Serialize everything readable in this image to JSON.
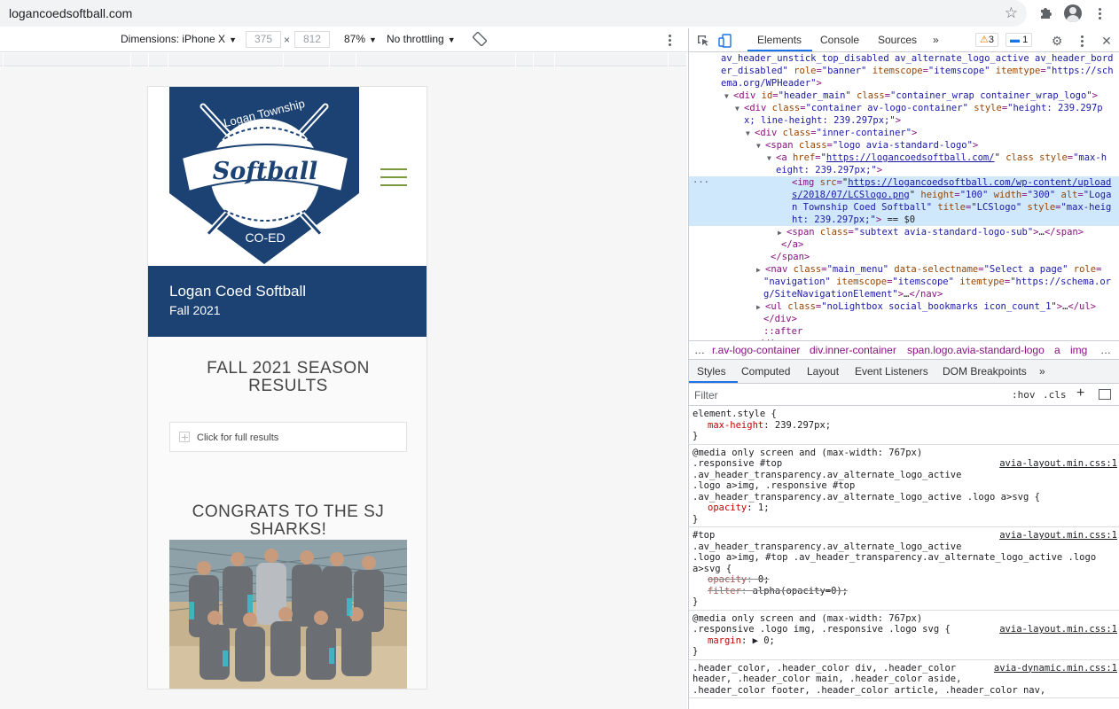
{
  "browser": {
    "url": "logancoedsoftball.com"
  },
  "device_toolbar": {
    "dimensions_label": "Dimensions: iPhone X",
    "width": "375",
    "height": "812",
    "times": "×",
    "zoom": "87%",
    "throttle": "No throttling"
  },
  "page": {
    "logo_text_top": "Logan Township",
    "logo_text_main": "Softball",
    "logo_text_bottom": "CO-ED",
    "site_title": "Logan Coed Softball",
    "site_subtitle": "Fall 2021",
    "heading1_line1": "FALL 2021 SEASON",
    "heading1_line2": "RESULTS",
    "accordion_label": "Click for full results",
    "heading2_line1": "CONGRATS TO THE SJ",
    "heading2_line2": "SHARKS!"
  },
  "devtools": {
    "tabs": [
      "Elements",
      "Console",
      "Sources"
    ],
    "more_tabs": "»",
    "warnings": "3",
    "messages": "1",
    "dom_lines": [
      {
        "indent": 36,
        "parts": [
          [
            "av",
            "av_header_unstick_top_disabled av_alternate_logo_active av_header_bord"
          ]
        ]
      },
      {
        "indent": 36,
        "parts": [
          [
            "av",
            "er_disabled\""
          ],
          [
            "an",
            " role"
          ],
          [
            "tn",
            "="
          ],
          [
            "av",
            "\"banner\""
          ],
          [
            "an",
            " itemscope"
          ],
          [
            "tn",
            "="
          ],
          [
            "av",
            "\"itemscope\""
          ],
          [
            "an",
            " itemtype"
          ],
          [
            "tn",
            "="
          ],
          [
            "av",
            "\"https://sch"
          ]
        ]
      },
      {
        "indent": 36,
        "parts": [
          [
            "av",
            "ema.org/WPHeader\""
          ],
          [
            "tn",
            ">"
          ]
        ]
      },
      {
        "indent": 50,
        "tri": "▼",
        "parts": [
          [
            "tn",
            "<div"
          ],
          [
            "an",
            " id"
          ],
          [
            "tn",
            "="
          ],
          [
            "av",
            "\"header_main\""
          ],
          [
            "an",
            " class"
          ],
          [
            "tn",
            "="
          ],
          [
            "av",
            "\"container_wrap container_wrap_logo\""
          ],
          [
            "tn",
            ">"
          ]
        ]
      },
      {
        "indent": 62,
        "tri": "▼",
        "parts": [
          [
            "tn",
            "<div"
          ],
          [
            "an",
            " class"
          ],
          [
            "tn",
            "="
          ],
          [
            "av",
            "\"container av-logo-container\""
          ],
          [
            "an",
            " style"
          ],
          [
            "tn",
            "="
          ],
          [
            "av",
            "\"height: 239.297p"
          ]
        ]
      },
      {
        "indent": 62,
        "parts": [
          [
            "av",
            "x; line-height: 239.297px;\""
          ],
          [
            "tn",
            ">"
          ]
        ]
      },
      {
        "indent": 74,
        "tri": "▼",
        "parts": [
          [
            "tn",
            "<div"
          ],
          [
            "an",
            " class"
          ],
          [
            "tn",
            "="
          ],
          [
            "av",
            "\"inner-container\""
          ],
          [
            "tn",
            ">"
          ]
        ]
      },
      {
        "indent": 86,
        "tri": "▼",
        "parts": [
          [
            "tn",
            "<span"
          ],
          [
            "an",
            " class"
          ],
          [
            "tn",
            "="
          ],
          [
            "av",
            "\"logo avia-standard-logo\""
          ],
          [
            "tn",
            ">"
          ]
        ]
      },
      {
        "indent": 98,
        "tri": "▼",
        "parts": [
          [
            "tn",
            "<a"
          ],
          [
            "an",
            " href"
          ],
          [
            "tn",
            "="
          ],
          [
            "tx",
            "\""
          ],
          [
            "ln",
            "https://logancoedsoftball.com/"
          ],
          [
            "tx",
            "\""
          ],
          [
            "an",
            " class style"
          ],
          [
            "tn",
            "="
          ],
          [
            "av",
            "\"max-h"
          ]
        ]
      },
      {
        "indent": 98,
        "parts": [
          [
            "av",
            "eight: 239.297px;\""
          ],
          [
            "tn",
            ">"
          ]
        ]
      },
      {
        "indent": 116,
        "sel": true,
        "parts": [
          [
            "tn",
            "<img"
          ],
          [
            "an",
            " src"
          ],
          [
            "tn",
            "="
          ],
          [
            "tx",
            "\""
          ],
          [
            "ln",
            "https://logancoedsoftball.com/wp-content/upload"
          ]
        ]
      },
      {
        "indent": 116,
        "sel": true,
        "parts": [
          [
            "ln",
            "s/2018/07/LCSlogo.png"
          ],
          [
            "tx",
            "\""
          ],
          [
            "an",
            " height"
          ],
          [
            "tn",
            "="
          ],
          [
            "av",
            "\"100\""
          ],
          [
            "an",
            " width"
          ],
          [
            "tn",
            "="
          ],
          [
            "av",
            "\"300\""
          ],
          [
            "an",
            " alt"
          ],
          [
            "tn",
            "="
          ],
          [
            "av",
            "\"Loga"
          ]
        ]
      },
      {
        "indent": 116,
        "sel": true,
        "parts": [
          [
            "av",
            "n Township Coed Softball\""
          ],
          [
            "an",
            " title"
          ],
          [
            "tn",
            "="
          ],
          [
            "av",
            "\"LCSlogo\""
          ],
          [
            "an",
            " style"
          ],
          [
            "tn",
            "="
          ],
          [
            "av",
            "\"max-heig"
          ]
        ]
      },
      {
        "indent": 116,
        "sel": true,
        "parts": [
          [
            "av",
            "ht: 239.297px;\""
          ],
          [
            "tn",
            ">"
          ],
          [
            "tx",
            " == $0"
          ]
        ]
      },
      {
        "indent": 110,
        "tri": "▶",
        "parts": [
          [
            "tn",
            "<span"
          ],
          [
            "an",
            " class"
          ],
          [
            "tn",
            "="
          ],
          [
            "av",
            "\"subtext avia-standard-logo-sub\""
          ],
          [
            "tn",
            ">"
          ],
          [
            "tx",
            "…"
          ],
          [
            "tn",
            "</span>"
          ]
        ]
      },
      {
        "indent": 104,
        "parts": [
          [
            "tn",
            "</a>"
          ]
        ]
      },
      {
        "indent": 92,
        "parts": [
          [
            "tn",
            "</span>"
          ]
        ]
      },
      {
        "indent": 86,
        "tri": "▶",
        "parts": [
          [
            "tn",
            "<nav"
          ],
          [
            "an",
            " class"
          ],
          [
            "tn",
            "="
          ],
          [
            "av",
            "\"main_menu\""
          ],
          [
            "an",
            " data-selectname"
          ],
          [
            "tn",
            "="
          ],
          [
            "av",
            "\"Select a page\""
          ],
          [
            "an",
            " role"
          ],
          [
            "tn",
            "="
          ]
        ]
      },
      {
        "indent": 84,
        "parts": [
          [
            "av",
            "\"navigation\""
          ],
          [
            "an",
            " itemscope"
          ],
          [
            "tn",
            "="
          ],
          [
            "av",
            "\"itemscope\""
          ],
          [
            "an",
            " itemtype"
          ],
          [
            "tn",
            "="
          ],
          [
            "av",
            "\"https://schema.or"
          ]
        ]
      },
      {
        "indent": 84,
        "parts": [
          [
            "av",
            "g/SiteNavigationElement\""
          ],
          [
            "tn",
            ">"
          ],
          [
            "tx",
            "…"
          ],
          [
            "tn",
            "</nav>"
          ]
        ]
      },
      {
        "indent": 86,
        "tri": "▶",
        "parts": [
          [
            "tn",
            "<ul"
          ],
          [
            "an",
            " class"
          ],
          [
            "tn",
            "="
          ],
          [
            "av",
            "\"noLightbox social_bookmarks icon_count_1\""
          ],
          [
            "tn",
            ">"
          ],
          [
            "tx",
            "…"
          ],
          [
            "tn",
            "</ul>"
          ]
        ]
      },
      {
        "indent": 84,
        "parts": [
          [
            "tn",
            "</div>"
          ]
        ]
      },
      {
        "indent": 84,
        "parts": [
          [
            "ps",
            "::after"
          ]
        ]
      },
      {
        "indent": 72,
        "parts": [
          [
            "tn",
            "</div>"
          ]
        ]
      }
    ],
    "breadcrumbs": [
      "…",
      "r.av-logo-container",
      "div.inner-container",
      "span.logo.avia-standard-logo",
      "a",
      "img",
      "…"
    ],
    "styles_tabs": [
      "Styles",
      "Computed",
      "Layout",
      "Event Listeners",
      "DOM Breakpoints",
      "»"
    ],
    "filter_placeholder": "Filter",
    "hov": ":hov",
    "cls": ".cls",
    "rules": [
      {
        "lines": [
          "element.style {"
        ],
        "props": [
          {
            "name": "max-height",
            "value": "239.297px;",
            "struck": false
          }
        ],
        "source": ""
      },
      {
        "lines": [
          "@media only screen and (max-width: 767px)",
          ".responsive #top",
          ".av_header_transparency.av_alternate_logo_active",
          ".logo a>img, .responsive #top",
          ".av_header_transparency.av_alternate_logo_active .logo a>svg {"
        ],
        "props": [
          {
            "name": "opacity",
            "value": "1;",
            "struck": false
          }
        ],
        "source": "avia-layout.min.css:1"
      },
      {
        "lines": [
          "#top",
          ".av_header_transparency.av_alternate_logo_active",
          ".logo a>img, #top .av_header_transparency.av_alternate_logo_active .logo",
          "a>svg {"
        ],
        "props": [
          {
            "name": "opacity",
            "value": "0;",
            "struck": true
          },
          {
            "name": "filter",
            "value": "alpha(opacity=0);",
            "struck": true
          }
        ],
        "source": "avia-layout.min.css:1"
      },
      {
        "lines": [
          "@media only screen and (max-width: 767px)",
          ".responsive .logo img, .responsive .logo svg {"
        ],
        "props": [
          {
            "name": "margin",
            "value": "▶ 0;",
            "struck": false
          }
        ],
        "source": "avia-layout.min.css:1"
      },
      {
        "lines": [
          ".header_color, .header_color div, .header_color",
          "header, .header_color main, .header_color aside,",
          ".header_color footer, .header_color article, .header_color nav,"
        ],
        "props": [],
        "source": "avia-dynamic.min.css:1"
      }
    ]
  },
  "colors": {
    "brand_blue": "#1c4273",
    "menu_green": "#7b9a40",
    "devtools_accent": "#1a73e8"
  }
}
